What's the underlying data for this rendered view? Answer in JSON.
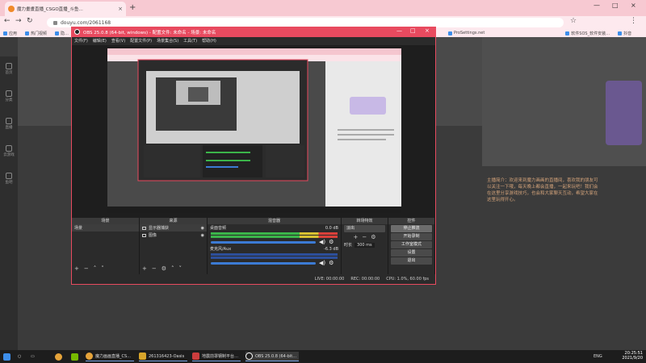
{
  "browser": {
    "tab_title": "魔力畫畫直播_CSGO直播_斗鱼…",
    "url": "douyu.com/2061168",
    "bookmarks": [
      "应用",
      "热门视频",
      "隐…",
      "",
      "",
      "",
      "",
      "",
      "",
      "ProSettings.net",
      "",
      "",
      "",
      "",
      "软件SOS_软件安装…",
      "",
      "抖音"
    ]
  },
  "obs": {
    "title": "OBS 25.0.8 (64-bit, windows) - 配置文件: 未命名 - 场景: 未命名",
    "menu": [
      "文件(F)",
      "编辑(E)",
      "查看(V)",
      "配置文件(P)",
      "场景集合(S)",
      "工具(T)",
      "帮助(H)"
    ],
    "docks": {
      "scenes": {
        "title": "场景",
        "items": [
          "场景"
        ]
      },
      "sources": {
        "title": "来源",
        "items": [
          "显示器捕获",
          "图像"
        ]
      },
      "mixer": {
        "title": "混音器",
        "tracks": [
          {
            "name": "桌面音频",
            "db": "0.0 dB"
          },
          {
            "name": "麦克风/Aux",
            "db": "-6.3 dB"
          }
        ]
      },
      "transitions": {
        "title": "转场特效",
        "type": "淡出",
        "duration_label": "时长",
        "duration": "300 ms"
      },
      "controls": {
        "title": "控件",
        "buttons": [
          "停止推流",
          "开始录制",
          "工作室模式",
          "设置",
          "退出"
        ]
      }
    },
    "status": [
      "LIVE: 00:00:00",
      "REC: 00:00:00",
      "CPU: 1.0%, 60.00 fps"
    ]
  },
  "page": {
    "leftnav": [
      "首页",
      "分类",
      "直播",
      "云游戏",
      "鱼吧"
    ],
    "right_text": "主播简介：欢迎来到魔力画画的直播间，喜欢我的朋友可以关注一下哦，每天晚上都会直播，一起来玩吧！我们会在这里分享游戏技巧，也会和大家聊天互动，希望大家在这里玩得开心。"
  },
  "taskbar": {
    "items": [
      "魔力画画直播_CS…",
      "261316423-Oasis",
      "地震前罩钢制平台…",
      "OBS 25.0.8 (64-bit…"
    ],
    "time": "20:25:51",
    "date": "2021/9/20",
    "lang": "ENG"
  }
}
